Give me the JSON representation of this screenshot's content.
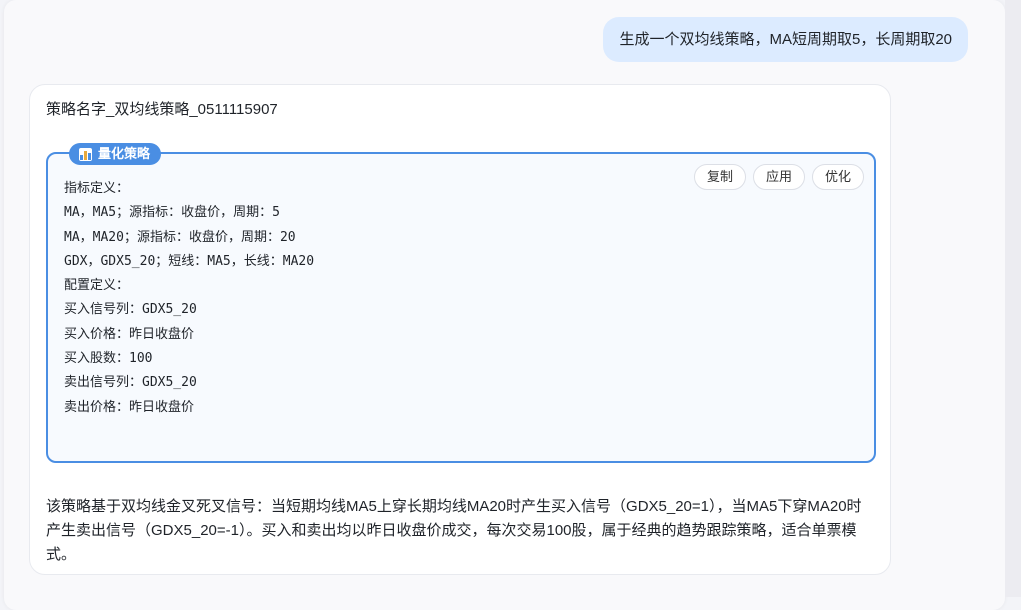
{
  "colors": {
    "accent": "#4a8ee3",
    "user_bubble": "#dcebff",
    "strategy_box_bg": "#f7fafe",
    "page_bg": "#f3f4f8"
  },
  "user_message": "生成一个双均线策略，MA短周期取5，长周期取20",
  "assistant": {
    "strategy_name": "策略名字_双均线策略_0511115907",
    "strategy_box": {
      "tag_icon": "bar-chart-icon",
      "tag_label": "量化策略",
      "actions": {
        "copy": "复制",
        "apply": "应用",
        "optimize": "优化"
      },
      "lines": [
        "指标定义：",
        "MA，MA5；源指标：收盘价，周期：5",
        "MA，MA20；源指标：收盘价，周期：20",
        "GDX，GDX5_20；短线：MA5，长线：MA20",
        "配置定义：",
        "买入信号列：GDX5_20",
        "买入价格：昨日收盘价",
        "买入股数：100",
        "卖出信号列：GDX5_20",
        "卖出价格：昨日收盘价"
      ]
    },
    "description": "该策略基于双均线金叉死叉信号：当短期均线MA5上穿长期均线MA20时产生买入信号（GDX5_20=1），当MA5下穿MA20时产生卖出信号（GDX5_20=-1）。买入和卖出均以昨日收盘价成交，每次交易100股，属于经典的趋势跟踪策略，适合单票模式。"
  }
}
